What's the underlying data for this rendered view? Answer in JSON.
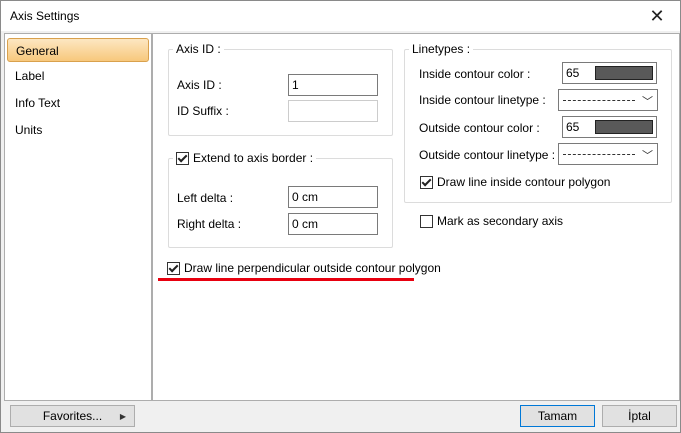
{
  "window": {
    "title": "Axis Settings",
    "close_glyph": "✕"
  },
  "sidebar": {
    "items": [
      {
        "label": "General",
        "active": true
      },
      {
        "label": "Label",
        "active": false
      },
      {
        "label": "Info Text",
        "active": false
      },
      {
        "label": "Units",
        "active": false
      }
    ]
  },
  "axis_id_group": {
    "title": "Axis ID :",
    "axis_id_label": "Axis ID :",
    "axis_id_value": "1",
    "id_suffix_label": "ID Suffix :",
    "id_suffix_value": ""
  },
  "extend_group": {
    "title": "Extend to axis border :",
    "checked": true,
    "left_delta_label": "Left delta :",
    "left_delta_value": "0 cm",
    "right_delta_label": "Right delta :",
    "right_delta_value": "0 cm"
  },
  "linetypes_group": {
    "title": "Linetypes :",
    "inside_color_label": "Inside contour color :",
    "inside_color_value": "65",
    "inside_linetype_label": "Inside contour linetype :",
    "outside_color_label": "Outside contour color :",
    "outside_color_value": "65",
    "outside_linetype_label": "Outside contour linetype :",
    "draw_inside_label": "Draw line inside contour polygon",
    "draw_inside_checked": true
  },
  "secondary_axis": {
    "label": "Mark as secondary axis",
    "checked": false
  },
  "perpendicular": {
    "label": "Draw line perpendicular outside contour polygon",
    "checked": true
  },
  "footer": {
    "favorites_label": "Favorites...",
    "ok_label": "Tamam",
    "cancel_label": "İptal"
  },
  "colors": {
    "swatch": "#595959",
    "highlight": "#e8000f",
    "accent": "#0078d7"
  }
}
